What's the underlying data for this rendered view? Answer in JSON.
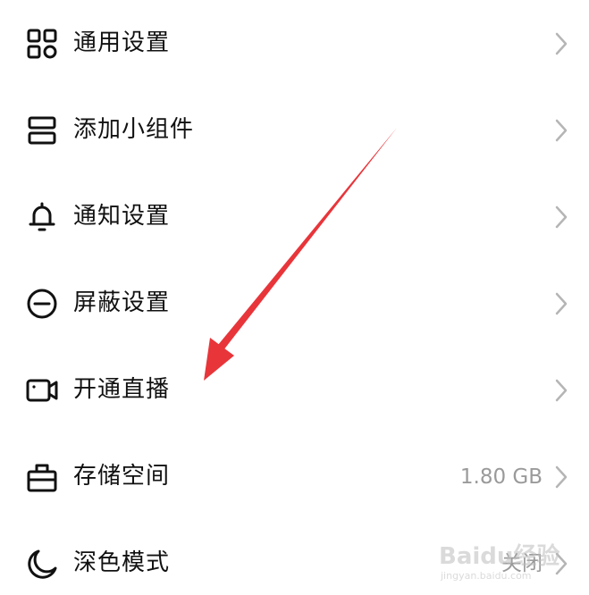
{
  "settings": {
    "items": [
      {
        "label": "通用设置",
        "icon": "grid-icon",
        "value": ""
      },
      {
        "label": "添加小组件",
        "icon": "widget-icon",
        "value": ""
      },
      {
        "label": "通知设置",
        "icon": "bell-icon",
        "value": ""
      },
      {
        "label": "屏蔽设置",
        "icon": "block-icon",
        "value": ""
      },
      {
        "label": "开通直播",
        "icon": "video-camera-icon",
        "value": ""
      },
      {
        "label": "存储空间",
        "icon": "storage-box-icon",
        "value": "1.80 GB"
      },
      {
        "label": "深色模式",
        "icon": "moon-icon",
        "value": "关闭"
      }
    ]
  },
  "watermark": {
    "text": "Baidu经验",
    "sub": "jingyan.baidu.com"
  },
  "colors": {
    "text": "#111111",
    "secondary": "#9a9a9a",
    "chevron": "#b5b5b5",
    "arrow": "#e8353a"
  }
}
